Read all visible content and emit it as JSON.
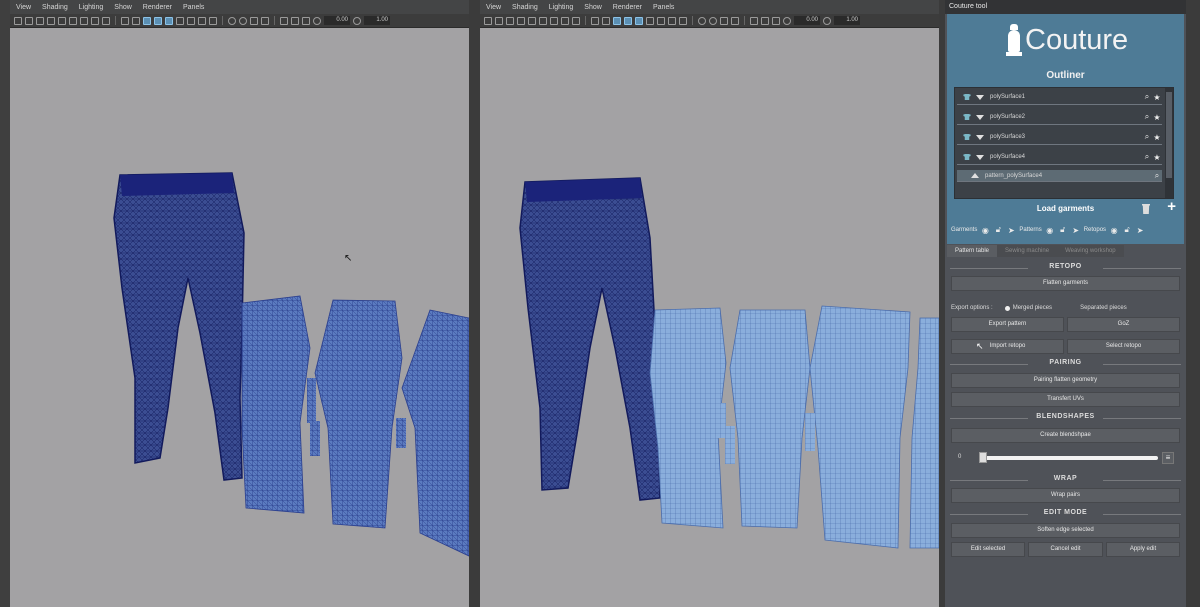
{
  "viewport_menu": [
    "View",
    "Shading",
    "Lighting",
    "Show",
    "Renderer",
    "Panels"
  ],
  "viewport_fields": {
    "value1": "0.00",
    "value2": "1.00"
  },
  "panel": {
    "window_title": "Couture tool",
    "logo_text": "Couture",
    "outliner_title": "Outliner",
    "outliner_items": [
      {
        "label": "polySurface1",
        "selected": false
      },
      {
        "label": "polySurface2",
        "selected": false
      },
      {
        "label": "polySurface3",
        "selected": false
      },
      {
        "label": "polySurface4",
        "selected": false
      },
      {
        "label": "pattern_polySurface4",
        "selected": true
      }
    ],
    "load_garments": "Load garments",
    "visibility": {
      "garments": "Garments",
      "patterns": "Patterns",
      "retopos": "Retopos"
    },
    "tabs": [
      {
        "label": "Pattern table",
        "active": true
      },
      {
        "label": "Sewing machine",
        "active": false
      },
      {
        "label": "Weaving workshop",
        "active": false
      }
    ],
    "retopo": {
      "title": "RETOPO",
      "flatten": "Flatten garments",
      "export_options": "Export options :",
      "merged": "Merged pieces",
      "separated": "Separated pieces",
      "export_pattern": "Export pattern",
      "goz": "GoZ",
      "import_retopo": "Import retopo",
      "select_retopo": "Select retopo"
    },
    "pairing": {
      "title": "PAIRING",
      "pairing_flatten": "Pairing flatten geometry",
      "transfert_uvs": "Transfert UVs"
    },
    "blendshapes": {
      "title": "BLENDSHAPES",
      "create": "Create blendshpae",
      "slider_value": "0",
      "slider_fraction": 0.0
    },
    "wrap": {
      "title": "WRAP",
      "wrap_pairs": "Wrap pairs"
    },
    "edit_mode": {
      "title": "EDIT MODE",
      "soften": "Soften edge selected",
      "edit_selected": "Edit selected",
      "cancel_edit": "Cancel edit",
      "apply_edit": "Apply edit"
    }
  },
  "colors": {
    "viewport_bg": "#a3a2a4",
    "garment_dark": "#1f2a78",
    "pattern_blue": "#4f6fb0",
    "pattern_light": "#7ea2d4",
    "panel_header": "#4e7b96"
  }
}
